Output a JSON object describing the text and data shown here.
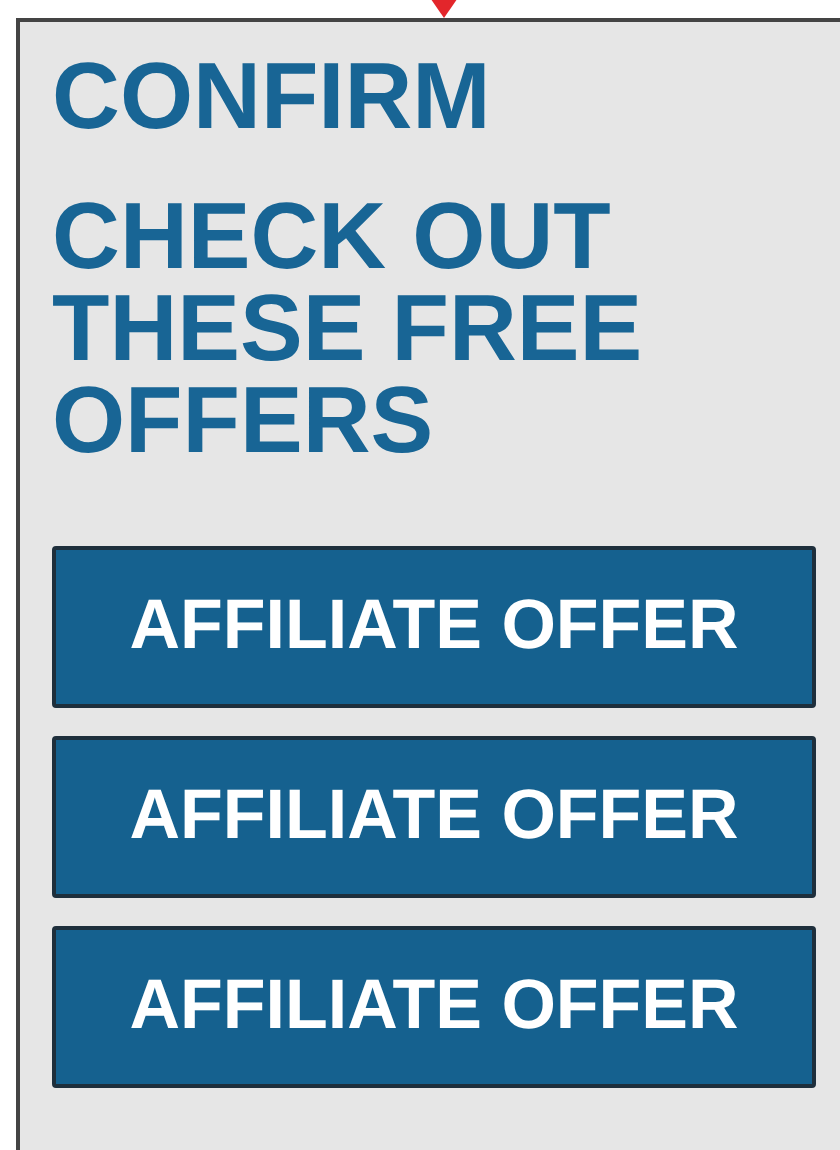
{
  "confirm_heading": "CONFIRM",
  "offers_heading": "CHECK OUT THESE FREE OFFERS",
  "offer_buttons": [
    {
      "label": "AFFILIATE OFFER"
    },
    {
      "label": "AFFILIATE OFFER"
    },
    {
      "label": "AFFILIATE OFFER"
    }
  ]
}
